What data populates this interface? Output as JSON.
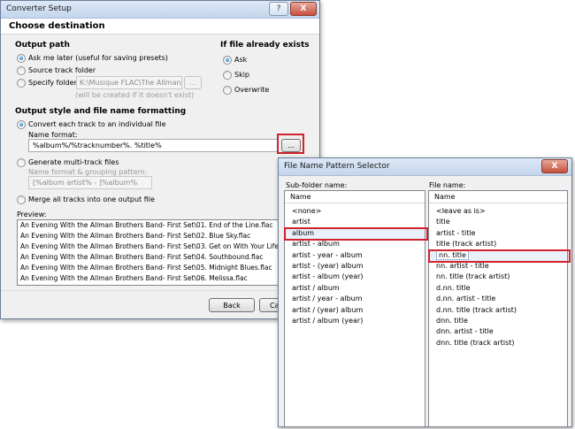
{
  "converter": {
    "title": "Converter Setup",
    "help_label": "?",
    "close_label": "X",
    "heading": "Choose destination",
    "output_path": {
      "label": "Output path",
      "ask_later": "Ask me later (useful for saving presets)",
      "source_folder": "Source track folder",
      "specify_folder": "Specify folder:",
      "folder_value": "K:\\Musique FLAC\\The Allman Brot",
      "browse_label": "...",
      "create_hint": "(will be created if it doesn't exist)"
    },
    "if_exists": {
      "label": "If file already exists",
      "options": [
        "Ask",
        "Skip",
        "Overwrite"
      ],
      "selected": "Ask"
    },
    "style": {
      "label": "Output style and file name formatting",
      "convert_each": "Convert each track to an individual file",
      "name_format_label": "Name format:",
      "name_format_value": "%album%/%tracknumber%. %title%",
      "name_browse_label": "...",
      "multi_track": "Generate multi-track files",
      "grouping_label": "Name format & grouping pattern:",
      "grouping_value": "[%album artist% - ]%album%",
      "merge_all": "Merge all tracks into one output file"
    },
    "preview": {
      "label": "Preview:",
      "rows": [
        "An Evening With the Allman Brothers Band- First Set\\01. End of the Line.flac",
        "An Evening With the Allman Brothers Band- First Set\\02. Blue Sky.flac",
        "An Evening With the Allman Brothers Band- First Set\\03. Get on With Your Life.flac",
        "An Evening With the Allman Brothers Band- First Set\\04. Southbound.flac",
        "An Evening With the Allman Brothers Band- First Set\\05. Midnight Blues.flac",
        "An Evening With the Allman Brothers Band- First Set\\06. Melissa.flac"
      ]
    },
    "buttons": {
      "back": "Back",
      "cancel": "Ca"
    }
  },
  "selector": {
    "title": "File Name Pattern Selector",
    "close_label": "X",
    "subfolder": {
      "label": "Sub-folder name:",
      "column": "Name",
      "items": [
        "<none>",
        "artist",
        "album",
        "artist - album",
        "artist - year - album",
        "artist - (year) album",
        "artist - album (year)",
        "artist / album",
        "artist / year - album",
        "artist / (year) album",
        "artist / album (year)"
      ],
      "selected": "album"
    },
    "filename": {
      "label": "File name:",
      "column": "Name",
      "items": [
        "<leave as is>",
        "title",
        "artist - title",
        "title (track artist)",
        "nn. title",
        "nn. artist - title",
        "nn. title (track artist)",
        "d.nn. title",
        "d.nn. artist - title",
        "d.nn. title (track artist)",
        "dnn. title",
        "dnn. artist - title",
        "dnn. title (track artist)"
      ],
      "selected": "nn. title"
    }
  },
  "colors": {
    "highlight_border": "#d0232b",
    "title_gradient_top": "#dde9f7"
  }
}
